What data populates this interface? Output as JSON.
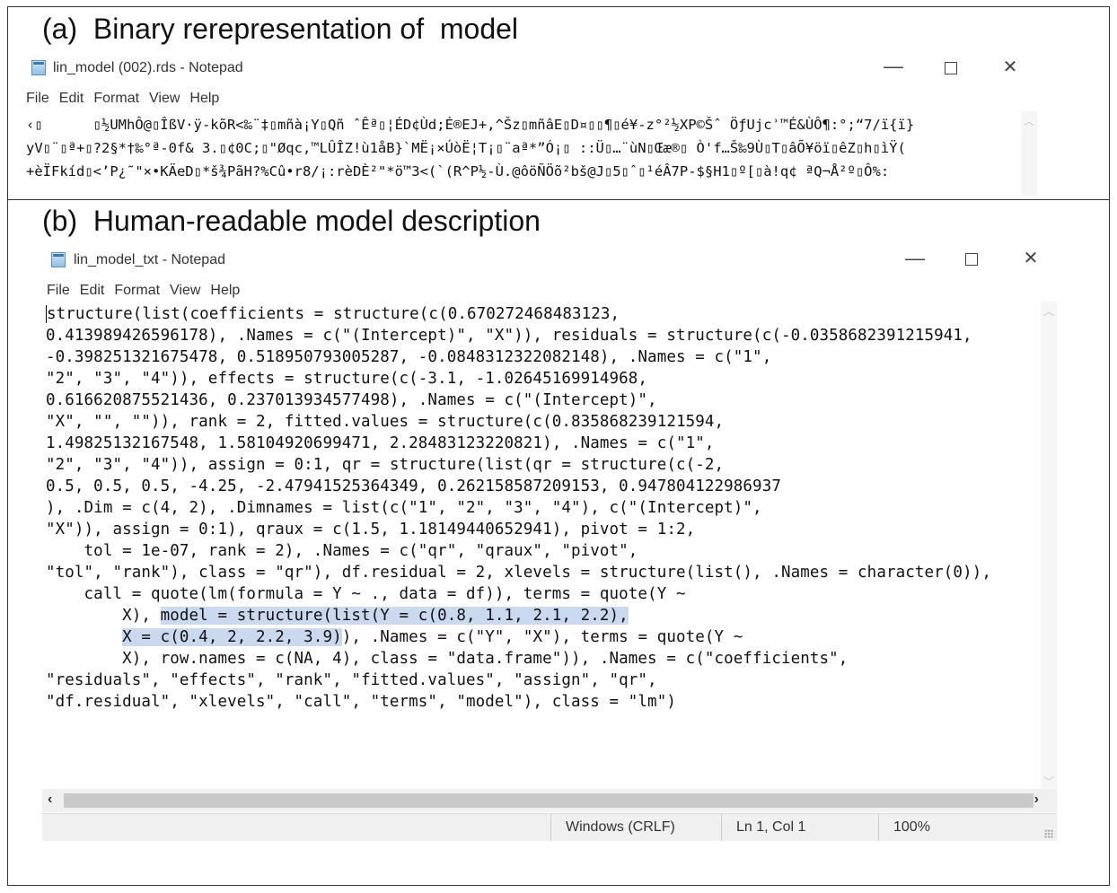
{
  "panel_a": {
    "caption": "(a)  Binary rerepresentation of  model",
    "window_title": "lin_model (002).rds - Notepad",
    "menu": [
      "File",
      "Edit",
      "Format",
      "View",
      "Help"
    ],
    "window_buttons": {
      "minimize": "—",
      "close": "✕"
    },
    "content_lines": [
      "‹▯      ▯½UMhÔ@▯ÎßV·ÿ-kõR<‰¨‡▯mñà¡Y▯Qñ ˆÊª▯¦ÉD¢Ùd;É®EJ+,^Šz▯mñâE▯D¤▯▯¶▯é¥-z°²½XP©Šˆ ÖƒUjcʾ™É&ÙÔ¶:°;“7/ï{ï}",
      "yV▯¨▯ª+▯?2§*†‰°ª-0f& 3.▯¢0C;▯\"Øqc,™LÛÎZ!ù1åB}`MË¡×ÚòË¦T¡▯¨aª*”Ó¡▯ ::Ü▯…¨ùN▯Œæ®▯ Ò'f…Š‰9Ù▯T▯âÕ¥öï▯êZ▯h▯ìŸ(",
      "+èÏFkíd▯<’P¿˜\"×•KÄeD▯*š¾PãH?%Cû•r8/¡:rèDÈ²\"*ö™3<(`(R^P½-Ù.@ôöÑÖõ²bš@J▯5▯ˆ▯¹éÂ7P-$§H1▯º[▯à!q¢ ªQ¬Å²º▯Ô%:"
    ]
  },
  "panel_b": {
    "caption": "(b)  Human-readable model description",
    "window_title": "lin_model_txt - Notepad",
    "menu": [
      "File",
      "Edit",
      "Format",
      "View",
      "Help"
    ],
    "window_buttons": {
      "minimize": "—",
      "close": "✕"
    },
    "code": {
      "l01": "structure(list(coefficients = structure(c(0.670272468483123,",
      "l02": "0.413989426596178), .Names = c(\"(Intercept)\", \"X\")), residuals = structure(c(-0.0358682391215941,",
      "l03": "-0.398251321675478, 0.518950793005287, -0.0848312322082148), .Names = c(\"1\",",
      "l04": "\"2\", \"3\", \"4\")), effects = structure(c(-3.1, -1.02645169914968,",
      "l05": "0.616620875521436, 0.237013934577498), .Names = c(\"(Intercept)\",",
      "l06": "\"X\", \"\", \"\")), rank = 2, fitted.values = structure(c(0.835868239121594,",
      "l07": "1.49825132167548, 1.58104920699471, 2.28483123220821), .Names = c(\"1\",",
      "l08": "\"2\", \"3\", \"4\")), assign = 0:1, qr = structure(list(qr = structure(c(-2,",
      "l09": "0.5, 0.5, 0.5, -4.25, -2.47941525364349, 0.262158587209153, 0.947804122986937",
      "l10": "), .Dim = c(4, 2), .Dimnames = list(c(\"1\", \"2\", \"3\", \"4\"), c(\"(Intercept)\",",
      "l11": "\"X\")), assign = 0:1), qraux = c(1.5, 1.18149440652941), pivot = 1:2,",
      "l12": "    tol = 1e-07, rank = 2), .Names = c(\"qr\", \"qraux\", \"pivot\",",
      "l13": "\"tol\", \"rank\"), class = \"qr\"), df.residual = 2, xlevels = structure(list(), .Names = character(0)),",
      "l14": "    call = quote(lm(formula = Y ~ ., data = df)), terms = quote(Y ~",
      "l15a": "        X), ",
      "l15b": "model = structure(list(Y = c(0.8, 1.1, 2.1, 2.2),",
      "l16a": "        ",
      "l16b": "X = c(0.4, 2, 2.2, 3.9)",
      "l16c": "), .Names = c(\"Y\", \"X\"), terms = quote(Y ~",
      "l17": "        X), row.names = c(NA, 4), class = \"data.frame\")), .Names = c(\"coefficients\",",
      "l18": "\"residuals\", \"effects\", \"rank\", \"fitted.values\", \"assign\", \"qr\",",
      "l19": "\"df.residual\", \"xlevels\", \"call\", \"terms\", \"model\"), class = \"lm\")"
    },
    "status": {
      "encoding": "Windows (CRLF)",
      "position": "Ln 1, Col 1",
      "zoom": "100%"
    }
  }
}
